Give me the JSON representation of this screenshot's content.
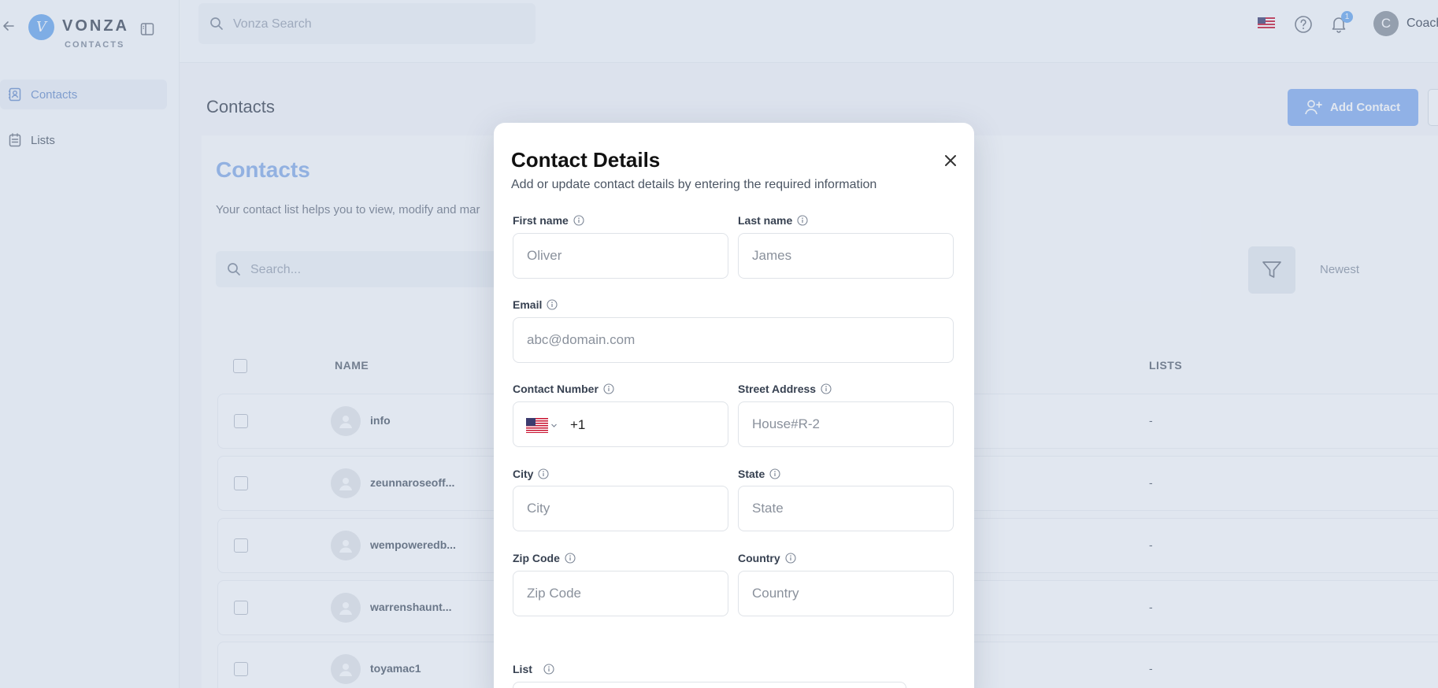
{
  "app": {
    "logo_letter": "V",
    "logo_name": "VONZA",
    "logo_sub": "CONTACTS"
  },
  "sidebar": {
    "items": [
      {
        "label": "Contacts",
        "icon": "contacts-icon",
        "active": true
      },
      {
        "label": "Lists",
        "icon": "lists-icon",
        "active": false
      }
    ]
  },
  "topbar": {
    "search_placeholder": "Vonza Search",
    "notification_count": "1",
    "avatar_letter": "C",
    "user_name": "Coach"
  },
  "page": {
    "title": "Contacts",
    "add_contact_label": "Add Contact"
  },
  "content": {
    "title": "Contacts",
    "description": "Your contact list helps you to view, modify and mar",
    "search_placeholder": "Search...",
    "sort_label": "Newest",
    "columns": {
      "name": "NAME",
      "lists": "LISTS"
    },
    "rows": [
      {
        "name": "info",
        "lists": "-"
      },
      {
        "name": "zeunnaroseoff...",
        "lists": "-"
      },
      {
        "name": "wempoweredb...",
        "lists": "-"
      },
      {
        "name": "warrenshaunt...",
        "lists": "-"
      },
      {
        "name": "toyamac1",
        "lists": "-"
      }
    ]
  },
  "modal": {
    "title": "Contact Details",
    "subtitle": "Add or update contact details by entering the required information",
    "fields": {
      "first_name": {
        "label": "First name",
        "placeholder": "Oliver"
      },
      "last_name": {
        "label": "Last name",
        "placeholder": "James"
      },
      "email": {
        "label": "Email",
        "placeholder": "abc@domain.com"
      },
      "contact_number": {
        "label": "Contact Number",
        "dial_code": "+1"
      },
      "street_address": {
        "label": "Street Address",
        "placeholder": "House#R-2"
      },
      "city": {
        "label": "City",
        "placeholder": "City"
      },
      "state": {
        "label": "State",
        "placeholder": "State"
      },
      "zip_code": {
        "label": "Zip Code",
        "placeholder": "Zip Code"
      },
      "country": {
        "label": "Country",
        "placeholder": "Country"
      },
      "list": {
        "label": "List"
      }
    }
  },
  "colors": {
    "accent": "#6aa8ee",
    "button": "#84aef0",
    "overlay": "#a8b9d4"
  }
}
